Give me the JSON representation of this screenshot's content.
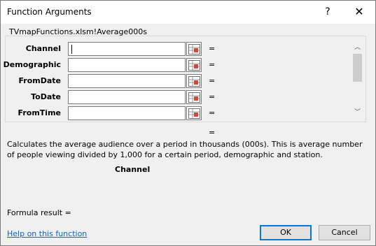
{
  "window": {
    "title": "Function Arguments",
    "help_glyph": "?",
    "close_glyph": "✕"
  },
  "group": {
    "title": "TVmapFunctions.xlsm!Average000s"
  },
  "arguments": [
    {
      "label": "Channel",
      "value": "",
      "eq": "="
    },
    {
      "label": "Demographic",
      "value": "",
      "eq": "="
    },
    {
      "label": "FromDate",
      "value": "",
      "eq": "="
    },
    {
      "label": "ToDate",
      "value": "",
      "eq": "="
    },
    {
      "label": "FromTime",
      "value": "",
      "eq": "="
    }
  ],
  "scroll": {
    "up": "︿",
    "down": "﹀"
  },
  "result_eq": "=",
  "description": "Calculates the average audience over a period in thousands (000s). This is average number of people viewing divided by 1,000 for a certain period, demographic and station.",
  "current_argument": "Channel",
  "formula_result": "Formula result =",
  "help_link": "Help on this function",
  "buttons": {
    "ok": "OK",
    "cancel": "Cancel"
  },
  "colors": {
    "link": "#0066cc",
    "ok_border": "#0078d7"
  }
}
